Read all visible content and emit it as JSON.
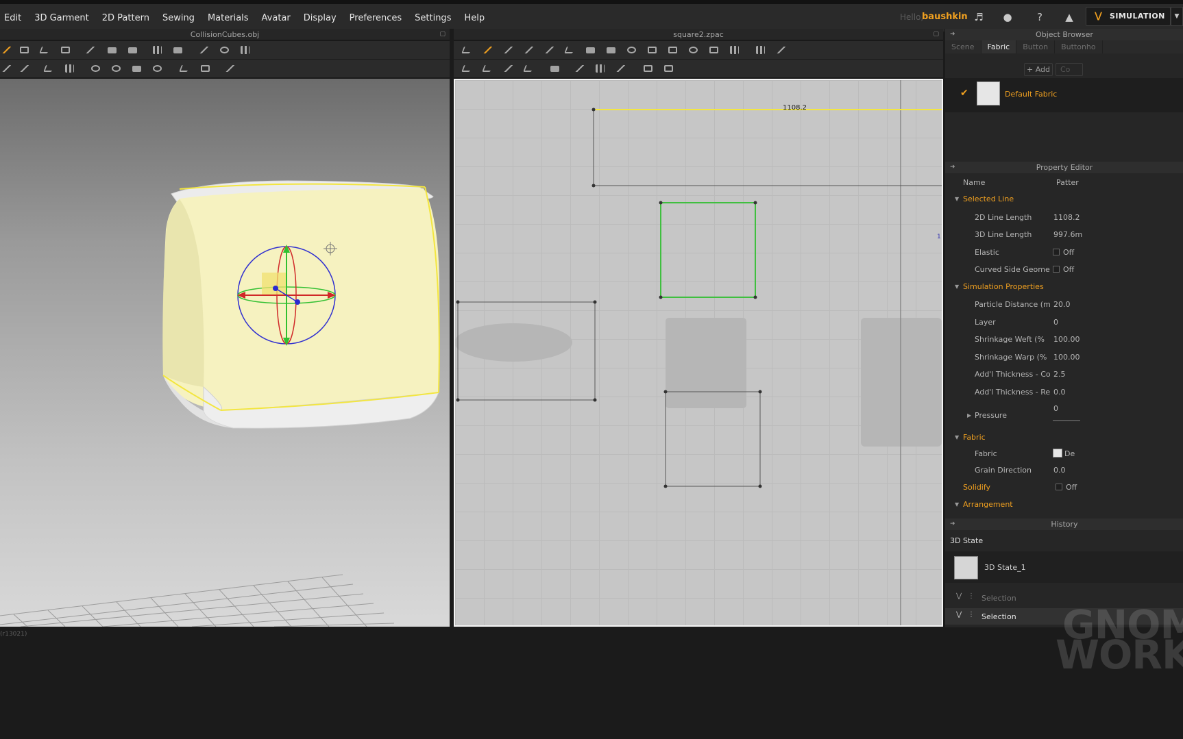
{
  "menubar": {
    "items": [
      "Edit",
      "3D Garment",
      "2D Pattern",
      "Sewing",
      "Materials",
      "Avatar",
      "Display",
      "Preferences",
      "Settings",
      "Help"
    ],
    "hello": "Hello,",
    "username": "baushkin",
    "icons": [
      "speaker-icon",
      "user-icon",
      "help-icon",
      "tshirt-icon"
    ],
    "simulation_label": "SIMULATION"
  },
  "panel_3d": {
    "title": "CollisionCubes.obj",
    "version_text": "(r13021)"
  },
  "panel_2d": {
    "title": "square2.zpac",
    "line_length_label": "1108.2",
    "edge_marker": "1"
  },
  "object_browser": {
    "title": "Object Browser",
    "tabs": [
      "Scene",
      "Fabric",
      "Button",
      "Buttonho"
    ],
    "active_tab": "Fabric",
    "add_label": "+ Add",
    "copy_label": "Co",
    "fabric_name": "Default Fabric"
  },
  "property_editor": {
    "title": "Property Editor",
    "name_col": "Name",
    "value_col": "Patter",
    "sections": [
      {
        "title": "Selected Line",
        "rows": [
          {
            "label": "2D Line Length",
            "value": "1108.2"
          },
          {
            "label": "3D Line Length",
            "value": "997.6m"
          },
          {
            "label": "Elastic",
            "value": "Off"
          },
          {
            "label": "Curved Side Geome",
            "value": "Off"
          }
        ]
      },
      {
        "title": "Simulation Properties",
        "rows": [
          {
            "label": "Particle Distance (m",
            "value": "20.0"
          },
          {
            "label": "Layer",
            "value": "0"
          },
          {
            "label": "Shrinkage Weft (%",
            "value": "100.00"
          },
          {
            "label": "Shrinkage Warp (%",
            "value": "100.00"
          },
          {
            "label": "Add'l Thickness - Collisio",
            "value": "2.5"
          },
          {
            "label": "Add'l Thickness - Renderi",
            "value": "0.0"
          },
          {
            "label": "Pressure",
            "value": "0"
          }
        ]
      },
      {
        "title": "Fabric",
        "rows": [
          {
            "label": "Fabric",
            "value": "De"
          },
          {
            "label": "Grain Direction",
            "value": "0.0"
          }
        ]
      }
    ],
    "solidify_label": "Solidify",
    "solidify_value": "Off",
    "arrangement_label": "Arrangement"
  },
  "history": {
    "title": "History",
    "state_header": "3D State",
    "state_item": "3D State_1",
    "selection_1": "Selection",
    "selection_2": "Selection"
  },
  "watermark": {
    "line1": "GNOM",
    "line2": "WORKSH"
  },
  "colors": {
    "accent": "#f0a020",
    "fabric": "#f7f3c0",
    "selected_line": "#f3e640",
    "selected_pattern": "#3fbf3f"
  }
}
